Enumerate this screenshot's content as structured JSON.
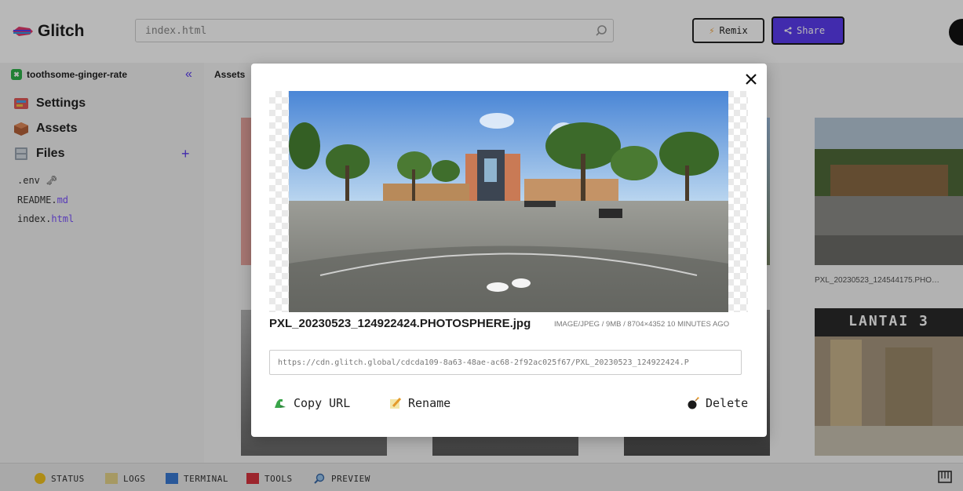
{
  "header": {
    "logo_text": "Glitch",
    "search_value": "index.html",
    "remix_label": "Remix",
    "share_label": "Share"
  },
  "sidebar": {
    "project_name": "toothsome-ginger-rate",
    "nav": [
      {
        "label": "Settings",
        "icon": "settings-icon"
      },
      {
        "label": "Assets",
        "icon": "assets-box-icon"
      },
      {
        "label": "Files",
        "icon": "files-cabinet-icon"
      }
    ],
    "files": [
      {
        "base": ".env",
        "ext": "",
        "suffix": "🗝"
      },
      {
        "base": "README.",
        "ext": "md"
      },
      {
        "base": "index.",
        "ext": "html"
      }
    ]
  },
  "assets": {
    "tab_label": "Assets",
    "visible_labels": [
      "PXL_20230523_124544175.PHO…"
    ],
    "sign_text": "LANTAI 3"
  },
  "modal": {
    "filename": "PXL_20230523_124922424.PHOTOSPHERE.jpg",
    "meta": "IMAGE/JPEG / 9MB / 8704×4352 10 MINUTES AGO",
    "url": "https://cdn.glitch.global/cdcda109-8a63-48ae-ac68-2f92ac025f67/PXL_20230523_124922424.P",
    "copy_label": "Copy URL",
    "rename_label": "Rename",
    "delete_label": "Delete"
  },
  "statusbar": {
    "items": [
      "STATUS",
      "LOGS",
      "TERMINAL",
      "TOOLS",
      "PREVIEW"
    ]
  },
  "colors": {
    "accent": "#5a3cf0",
    "share_bg": "#5a3cf0"
  }
}
